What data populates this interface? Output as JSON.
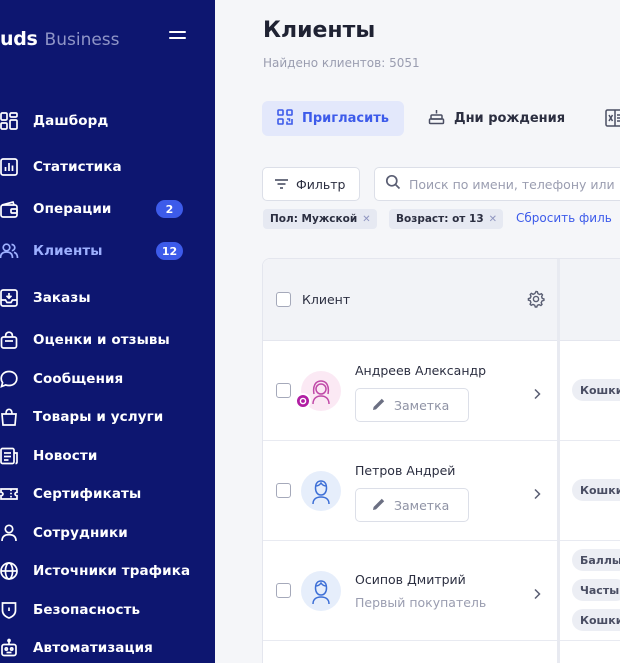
{
  "sidebar": {
    "logo_main": "uds",
    "logo_sub": "Business",
    "items": [
      {
        "label": "Дашборд",
        "icon": "dashboard-icon"
      },
      {
        "label": "Статистика",
        "icon": "chart-icon"
      },
      {
        "label": "Операции",
        "icon": "wallet-icon",
        "badge": "2"
      },
      {
        "label": "Клиенты",
        "icon": "users-icon",
        "badge": "12",
        "active": true
      },
      {
        "label": "Заказы",
        "icon": "inbox-icon"
      },
      {
        "label": "Оценки и отзывы",
        "icon": "bag-icon"
      },
      {
        "label": "Сообщения",
        "icon": "chat-icon"
      },
      {
        "label": "Товары и услуги",
        "icon": "shopping-bag-icon"
      },
      {
        "label": "Новости",
        "icon": "news-icon"
      },
      {
        "label": "Сертификаты",
        "icon": "ticket-icon"
      },
      {
        "label": "Сотрудники",
        "icon": "person-icon"
      },
      {
        "label": "Источники трафика",
        "icon": "globe-icon"
      },
      {
        "label": "Безопасность",
        "icon": "shield-icon"
      },
      {
        "label": "Автоматизация",
        "icon": "robot-icon"
      }
    ]
  },
  "header": {
    "title": "Клиенты",
    "found": "Найдено клиентов: 5051"
  },
  "toolbar": {
    "invite_label": "Пригласить",
    "birthdays_label": "Дни рождения"
  },
  "filters": {
    "filter_label": "Фильтр",
    "search_placeholder": "Поиск по имени, телефону или",
    "chips": [
      "Пол: Мужской",
      "Возраст: от 13"
    ],
    "reset_label": "Сбросить филь"
  },
  "table": {
    "column_client": "Клиент",
    "rows": [
      {
        "name": "Андреев Александр",
        "action": "Заметка",
        "tags": [
          "Кошки"
        ],
        "gender": "female"
      },
      {
        "name": "Петров Андрей",
        "action": "Заметка",
        "tags": [
          "Кошки"
        ],
        "gender": "male"
      },
      {
        "name": "Осипов Дмитрий",
        "subtitle": "Первый покупатель",
        "tags": [
          "Баллы",
          "Часты",
          "Кошки"
        ],
        "gender": "male"
      }
    ]
  },
  "colors": {
    "sidebar_bg": "#0d1670",
    "accent": "#3d5bea",
    "active_item": "#9db0ff",
    "badge_bg": "#3d5bea"
  }
}
